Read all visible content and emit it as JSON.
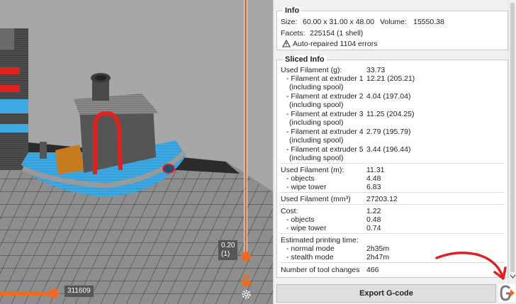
{
  "viewport": {
    "vertical_slider_label_line1": "0.20",
    "vertical_slider_label_line2": "(1)",
    "horizontal_slider_label": "311609"
  },
  "info": {
    "title": "Info",
    "size_label": "Size:",
    "size_value": "60.00 x 31.00 x 48.00",
    "volume_label": "Volume:",
    "volume_value": "15550.38",
    "facets_label": "Facets:",
    "facets_value": "225154 (1 shell)",
    "warning_text": "Auto-repaired 1104 errors"
  },
  "sliced": {
    "title": "Sliced Info",
    "filament_g_label": "Used Filament (g):",
    "filament_g_value": "33.73",
    "extruders": [
      {
        "label1": "- Filament at extruder 1",
        "label2": "(including spool)",
        "value": "12.21 (205.21)"
      },
      {
        "label1": "- Filament at extruder 2",
        "label2": "(including spool)",
        "value": "4.04 (197.04)"
      },
      {
        "label1": "- Filament at extruder 3",
        "label2": "(including spool)",
        "value": "11.25 (204.25)"
      },
      {
        "label1": "- Filament at extruder 4",
        "label2": "(including spool)",
        "value": "2.79 (195.79)"
      },
      {
        "label1": "- Filament at extruder 5",
        "label2": "(including spool)",
        "value": "3.44 (196.44)"
      }
    ],
    "filament_m_label": "Used Filament (m):",
    "filament_m_value": "11.31",
    "m_objects_label": "- objects",
    "m_objects_value": "4.48",
    "m_wipe_label": "- wipe tower",
    "m_wipe_value": "6.83",
    "filament_mm3_label": "Used Filament (mm³)",
    "filament_mm3_value": "27203.12",
    "cost_label": "Cost:",
    "cost_value": "1.22",
    "cost_objects_label": "- objects",
    "cost_objects_value": "0.48",
    "cost_wipe_label": "- wipe tower",
    "cost_wipe_value": "0.74",
    "time_label": "Estimated printing time:",
    "normal_label": "- normal mode",
    "normal_value": "2h35m",
    "stealth_label": "- stealth mode",
    "stealth_value": "2h47m",
    "tool_changes_label": "Number of tool changes",
    "tool_changes_value": "466"
  },
  "export_label": "Export G-code",
  "icons": {
    "warning": "warning-icon",
    "lock": "lock-icon",
    "gear": "gear-icon",
    "gcode": "gcode-preview-icon",
    "scroll_down": "chevron-down-icon"
  },
  "colors": {
    "accent": "#ed6b21",
    "boat_blue": "#3da9e2",
    "annotation_red": "#e02020"
  }
}
